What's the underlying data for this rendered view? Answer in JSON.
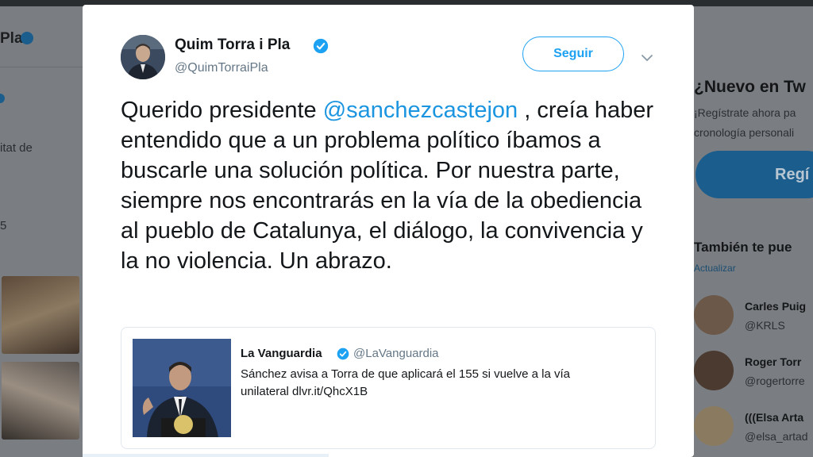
{
  "background": {
    "left_profile_name": "Pla",
    "left_fragment_1": "itat de",
    "left_fragment_2": "5",
    "right_heading": "¿Nuevo en Tw",
    "right_line_1": "¡Regístrate ahora pa",
    "right_line_2": "cronología personali",
    "right_signup_label": "Regí",
    "right_suggest_heading": "También te pue",
    "right_refresh": "Actualizar",
    "suggestions": [
      {
        "name": "Carles Puig",
        "handle": "@KRLS"
      },
      {
        "name": "Roger Torr",
        "handle": "@rogertorre"
      },
      {
        "name": "(((Elsa Arta",
        "handle": "@elsa_artad"
      }
    ]
  },
  "tweet": {
    "author_name": "Quim Torra i Pla",
    "author_handle": "@QuimTorraiPla",
    "follow_label": "Seguir",
    "text_before": "Querido presidente ",
    "mention": "@sanchezcastejon",
    "text_after": " , creía haber entendido que a un problema político íbamos a buscarle una solución política. Por nuestra parte, siempre nos encontrarás en la vía de la obediencia al pueblo de Catalunya, el diálogo, la convivencia y la no violencia. Un abrazo."
  },
  "quoted": {
    "name": "La Vanguardia",
    "handle": "@LaVanguardia",
    "text": "Sánchez avisa a Torra de que aplicará el 155 si vuelve a la vía unilateral dlvr.it/QhcX1B"
  },
  "colors": {
    "accent": "#1da1f2",
    "mention": "#1b95e0",
    "text": "#14171a",
    "secondary": "#657786"
  },
  "icons": {
    "verified": "verified-badge-icon",
    "menu": "chevron-down-icon"
  }
}
